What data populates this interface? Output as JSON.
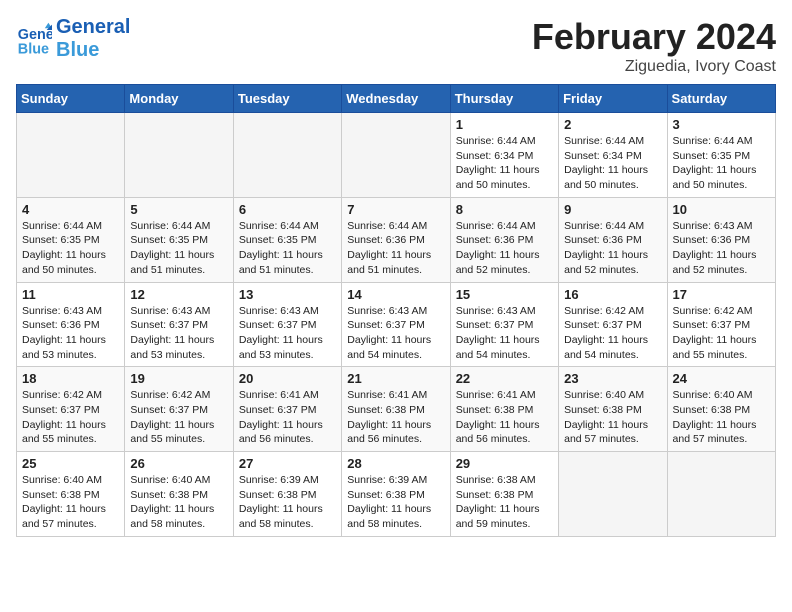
{
  "header": {
    "logo_line1": "General",
    "logo_line2": "Blue",
    "title": "February 2024",
    "subtitle": "Ziguedia, Ivory Coast"
  },
  "weekdays": [
    "Sunday",
    "Monday",
    "Tuesday",
    "Wednesday",
    "Thursday",
    "Friday",
    "Saturday"
  ],
  "weeks": [
    [
      {
        "day": "",
        "empty": true
      },
      {
        "day": "",
        "empty": true
      },
      {
        "day": "",
        "empty": true
      },
      {
        "day": "",
        "empty": true
      },
      {
        "day": "1",
        "sunrise": "6:44 AM",
        "sunset": "6:34 PM",
        "daylight": "11 hours and 50 minutes."
      },
      {
        "day": "2",
        "sunrise": "6:44 AM",
        "sunset": "6:34 PM",
        "daylight": "11 hours and 50 minutes."
      },
      {
        "day": "3",
        "sunrise": "6:44 AM",
        "sunset": "6:35 PM",
        "daylight": "11 hours and 50 minutes."
      }
    ],
    [
      {
        "day": "4",
        "sunrise": "6:44 AM",
        "sunset": "6:35 PM",
        "daylight": "11 hours and 50 minutes."
      },
      {
        "day": "5",
        "sunrise": "6:44 AM",
        "sunset": "6:35 PM",
        "daylight": "11 hours and 51 minutes."
      },
      {
        "day": "6",
        "sunrise": "6:44 AM",
        "sunset": "6:35 PM",
        "daylight": "11 hours and 51 minutes."
      },
      {
        "day": "7",
        "sunrise": "6:44 AM",
        "sunset": "6:36 PM",
        "daylight": "11 hours and 51 minutes."
      },
      {
        "day": "8",
        "sunrise": "6:44 AM",
        "sunset": "6:36 PM",
        "daylight": "11 hours and 52 minutes."
      },
      {
        "day": "9",
        "sunrise": "6:44 AM",
        "sunset": "6:36 PM",
        "daylight": "11 hours and 52 minutes."
      },
      {
        "day": "10",
        "sunrise": "6:43 AM",
        "sunset": "6:36 PM",
        "daylight": "11 hours and 52 minutes."
      }
    ],
    [
      {
        "day": "11",
        "sunrise": "6:43 AM",
        "sunset": "6:36 PM",
        "daylight": "11 hours and 53 minutes."
      },
      {
        "day": "12",
        "sunrise": "6:43 AM",
        "sunset": "6:37 PM",
        "daylight": "11 hours and 53 minutes."
      },
      {
        "day": "13",
        "sunrise": "6:43 AM",
        "sunset": "6:37 PM",
        "daylight": "11 hours and 53 minutes."
      },
      {
        "day": "14",
        "sunrise": "6:43 AM",
        "sunset": "6:37 PM",
        "daylight": "11 hours and 54 minutes."
      },
      {
        "day": "15",
        "sunrise": "6:43 AM",
        "sunset": "6:37 PM",
        "daylight": "11 hours and 54 minutes."
      },
      {
        "day": "16",
        "sunrise": "6:42 AM",
        "sunset": "6:37 PM",
        "daylight": "11 hours and 54 minutes."
      },
      {
        "day": "17",
        "sunrise": "6:42 AM",
        "sunset": "6:37 PM",
        "daylight": "11 hours and 55 minutes."
      }
    ],
    [
      {
        "day": "18",
        "sunrise": "6:42 AM",
        "sunset": "6:37 PM",
        "daylight": "11 hours and 55 minutes."
      },
      {
        "day": "19",
        "sunrise": "6:42 AM",
        "sunset": "6:37 PM",
        "daylight": "11 hours and 55 minutes."
      },
      {
        "day": "20",
        "sunrise": "6:41 AM",
        "sunset": "6:37 PM",
        "daylight": "11 hours and 56 minutes."
      },
      {
        "day": "21",
        "sunrise": "6:41 AM",
        "sunset": "6:38 PM",
        "daylight": "11 hours and 56 minutes."
      },
      {
        "day": "22",
        "sunrise": "6:41 AM",
        "sunset": "6:38 PM",
        "daylight": "11 hours and 56 minutes."
      },
      {
        "day": "23",
        "sunrise": "6:40 AM",
        "sunset": "6:38 PM",
        "daylight": "11 hours and 57 minutes."
      },
      {
        "day": "24",
        "sunrise": "6:40 AM",
        "sunset": "6:38 PM",
        "daylight": "11 hours and 57 minutes."
      }
    ],
    [
      {
        "day": "25",
        "sunrise": "6:40 AM",
        "sunset": "6:38 PM",
        "daylight": "11 hours and 57 minutes."
      },
      {
        "day": "26",
        "sunrise": "6:40 AM",
        "sunset": "6:38 PM",
        "daylight": "11 hours and 58 minutes."
      },
      {
        "day": "27",
        "sunrise": "6:39 AM",
        "sunset": "6:38 PM",
        "daylight": "11 hours and 58 minutes."
      },
      {
        "day": "28",
        "sunrise": "6:39 AM",
        "sunset": "6:38 PM",
        "daylight": "11 hours and 58 minutes."
      },
      {
        "day": "29",
        "sunrise": "6:38 AM",
        "sunset": "6:38 PM",
        "daylight": "11 hours and 59 minutes."
      },
      {
        "day": "",
        "empty": true
      },
      {
        "day": "",
        "empty": true
      }
    ]
  ]
}
